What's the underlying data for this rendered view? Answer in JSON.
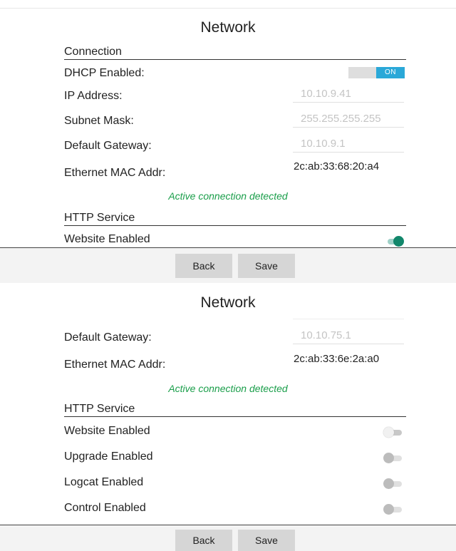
{
  "top": {
    "title": "Network",
    "connection_header": "Connection",
    "dhcp_label": "DHCP Enabled:",
    "dhcp_toggle_text": "ON",
    "ip_label": "IP Address:",
    "ip_value": "10.10.9.41",
    "subnet_label": "Subnet Mask:",
    "subnet_value": "255.255.255.255",
    "gateway_label": "Default Gateway:",
    "gateway_value": "10.10.9.1",
    "mac_label": "Ethernet MAC Addr:",
    "mac_value": "2c:ab:33:68:20:a4",
    "status": "Active connection detected",
    "http_header": "HTTP Service",
    "website_label": "Website Enabled",
    "back": "Back",
    "save": "Save"
  },
  "bottom": {
    "title": "Network",
    "gateway_label": "Default Gateway:",
    "gateway_value": "10.10.75.1",
    "mac_label": "Ethernet MAC Addr:",
    "mac_value": "2c:ab:33:6e:2a:a0",
    "status": "Active connection detected",
    "http_header": "HTTP Service",
    "website_label": "Website Enabled",
    "upgrade_label": "Upgrade Enabled",
    "logcat_label": "Logcat Enabled",
    "control_label": "Control Enabled",
    "back": "Back",
    "save": "Save"
  },
  "colors": {
    "accent_switch_on": "#12876b",
    "toggle_on": "#2aa8d8",
    "status_green": "#1a9e4a"
  }
}
